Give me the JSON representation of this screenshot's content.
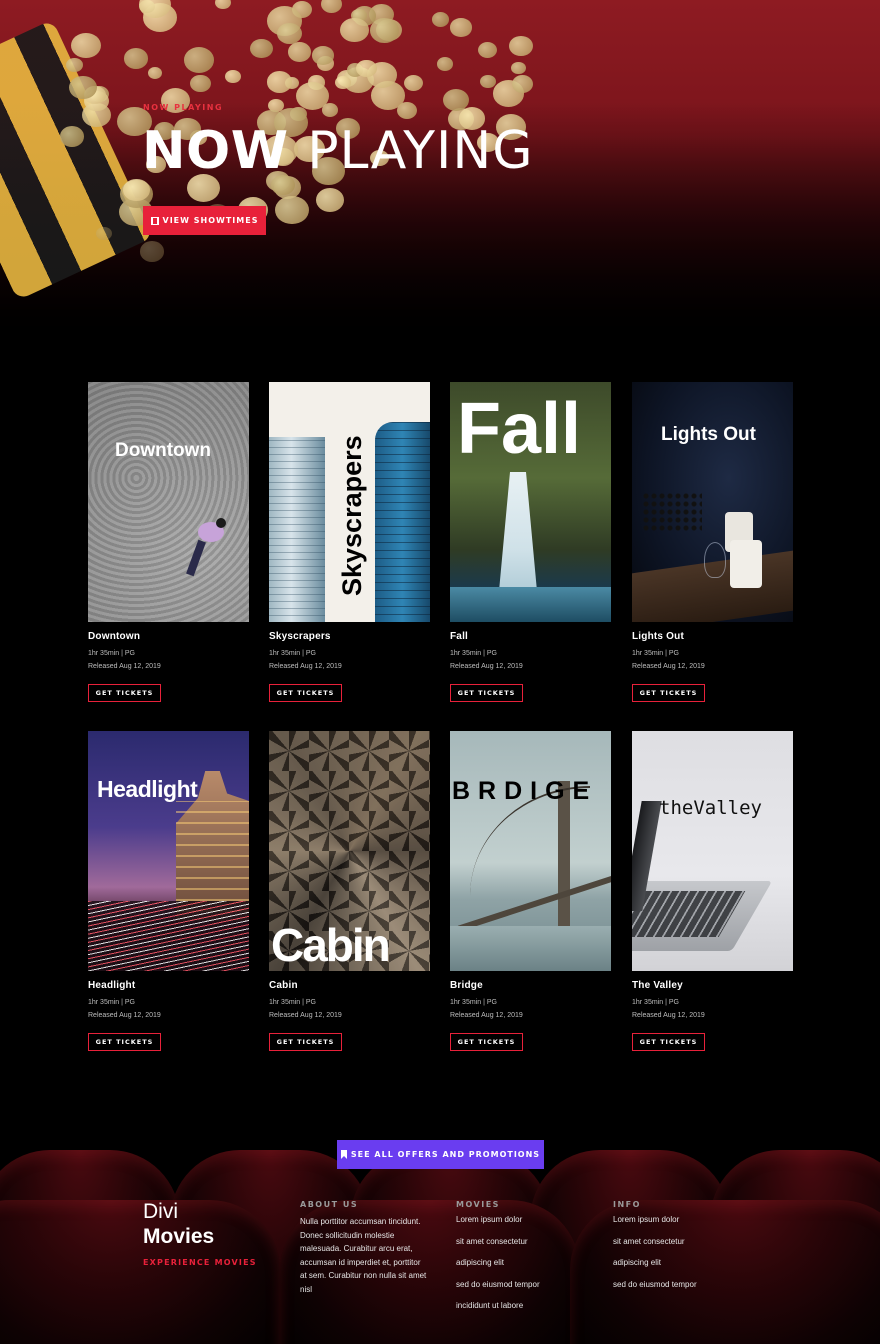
{
  "hero": {
    "kicker": "NOW PLAYING",
    "title_bold": "NOW",
    "title_light": "PLAYING",
    "button_label": "VIEW SHOWTIMES",
    "button_icon": "film-icon"
  },
  "movies": [
    {
      "title": "Downtown",
      "poster_text": "Downtown",
      "runtime": "1hr 35min | PG",
      "released": "Released Aug 12, 2019",
      "button": "GET TICKETS"
    },
    {
      "title": "Skyscrapers",
      "poster_text": "Skyscrapers",
      "runtime": "1hr 35min | PG",
      "released": "Released Aug 12, 2019",
      "button": "GET TICKETS"
    },
    {
      "title": "Fall",
      "poster_text": "Fall",
      "runtime": "1hr 35min | PG",
      "released": "Released Aug 12, 2019",
      "button": "GET TICKETS"
    },
    {
      "title": "Lights Out",
      "poster_text": "Lights Out",
      "runtime": "1hr 35min | PG",
      "released": "Released Aug 12, 2019",
      "button": "GET TICKETS"
    },
    {
      "title": "Headlight",
      "poster_text": "Headlight",
      "runtime": "1hr 35min | PG",
      "released": "Released Aug 12, 2019",
      "button": "GET TICKETS"
    },
    {
      "title": "Cabin",
      "poster_text": "Cabin",
      "runtime": "1hr 35min | PG",
      "released": "Released Aug 12, 2019",
      "button": "GET TICKETS"
    },
    {
      "title": "Bridge",
      "poster_text": "BRDIGE",
      "runtime": "1hr 35min | PG",
      "released": "Released Aug 12, 2019",
      "button": "GET TICKETS"
    },
    {
      "title": "The Valley",
      "poster_text": "theValley",
      "runtime": "1hr 35min | PG",
      "released": "Released Aug 12, 2019",
      "button": "GET TICKETS"
    }
  ],
  "offers": {
    "button_label": "SEE ALL OFFERS AND PROMOTIONS",
    "button_icon": "bookmark-icon"
  },
  "footer": {
    "brand_line1": "Divi",
    "brand_line2": "Movies",
    "tagline": "EXPERIENCE MOVIES",
    "about": {
      "heading": "ABOUT US",
      "text": "Nulla porttitor accumsan tincidunt. Donec sollicitudin molestie malesuada. Curabitur arcu erat, accumsan id imperdiet et, porttitor at sem. Curabitur non nulla sit amet nisl"
    },
    "movies_col": {
      "heading": "MOVIES",
      "links": [
        "Lorem ipsum dolor",
        "sit amet consectetur",
        "adipiscing elit",
        "sed do eiusmod tempor",
        "incididunt ut labore"
      ]
    },
    "info_col": {
      "heading": "INFO",
      "links": [
        "Lorem ipsum dolor",
        "sit amet consectetur",
        "adipiscing elit",
        "sed do eiusmod tempor"
      ]
    }
  },
  "colors": {
    "accent_red": "#e8213a",
    "accent_purple": "#6a3df0",
    "background": "#000000"
  }
}
